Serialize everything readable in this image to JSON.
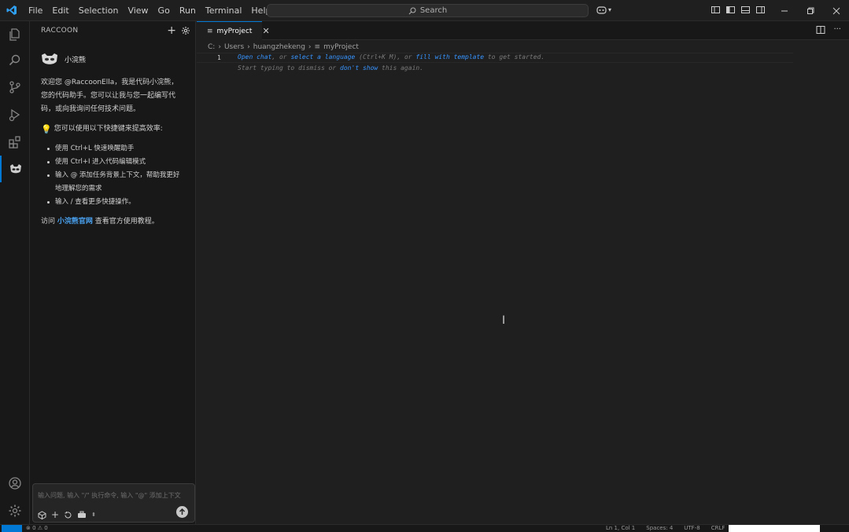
{
  "menu": [
    "File",
    "Edit",
    "Selection",
    "View",
    "Go",
    "Run",
    "Terminal",
    "Help"
  ],
  "search": {
    "label": "Search"
  },
  "sidebar": {
    "title": "RACCOON",
    "bot_name": "小浣熊",
    "intro": "欢迎您 @RaccoonElla，我是代码小浣熊，您的代码助手。您可以让我与您一起编写代码，或向我询问任何技术问题。",
    "tip_heading": "您可以使用以下快捷键来提高效率:",
    "tips": [
      "使用 Ctrl+L 快速唤醒助手",
      "使用 Ctrl+I 进入代码编辑模式",
      "输入 @ 添加任务背景上下文，帮助我更好地理解您的需求",
      "输入 / 查看更多快捷操作。"
    ],
    "visit_prefix": "访问",
    "visit_link": "小浣熊官网",
    "visit_suffix": "查看官方使用教程。",
    "chat_placeholder": "输入问题, 输入 \"/\" 执行命令, 输入 \"@\" 添加上下文"
  },
  "tab": {
    "label": "myProject"
  },
  "breadcrumb": [
    "C:",
    "Users",
    "huangzhekeng",
    "myProject"
  ],
  "editor": {
    "line_number": "1",
    "hint_line1": {
      "open_chat": "Open chat",
      "sep1": ", or ",
      "select_language": "select a language",
      "shortcut": " (Ctrl+K M), or ",
      "fill_template": "fill with template",
      "end": " to get started."
    },
    "hint_line2": {
      "start": "Start typing to dismiss or ",
      "dont_show": "don't show",
      "end": " this again."
    }
  },
  "status": {
    "problems": "⊗ 0 ⚠ 0",
    "position": "Ln 1, Col 1",
    "spaces": "Spaces: 4",
    "encoding": "UTF-8",
    "eol": "CRLF"
  },
  "colors": {
    "accent": "#0078d4",
    "link": "#3794ff",
    "brand_link": "#4aa3f2"
  }
}
